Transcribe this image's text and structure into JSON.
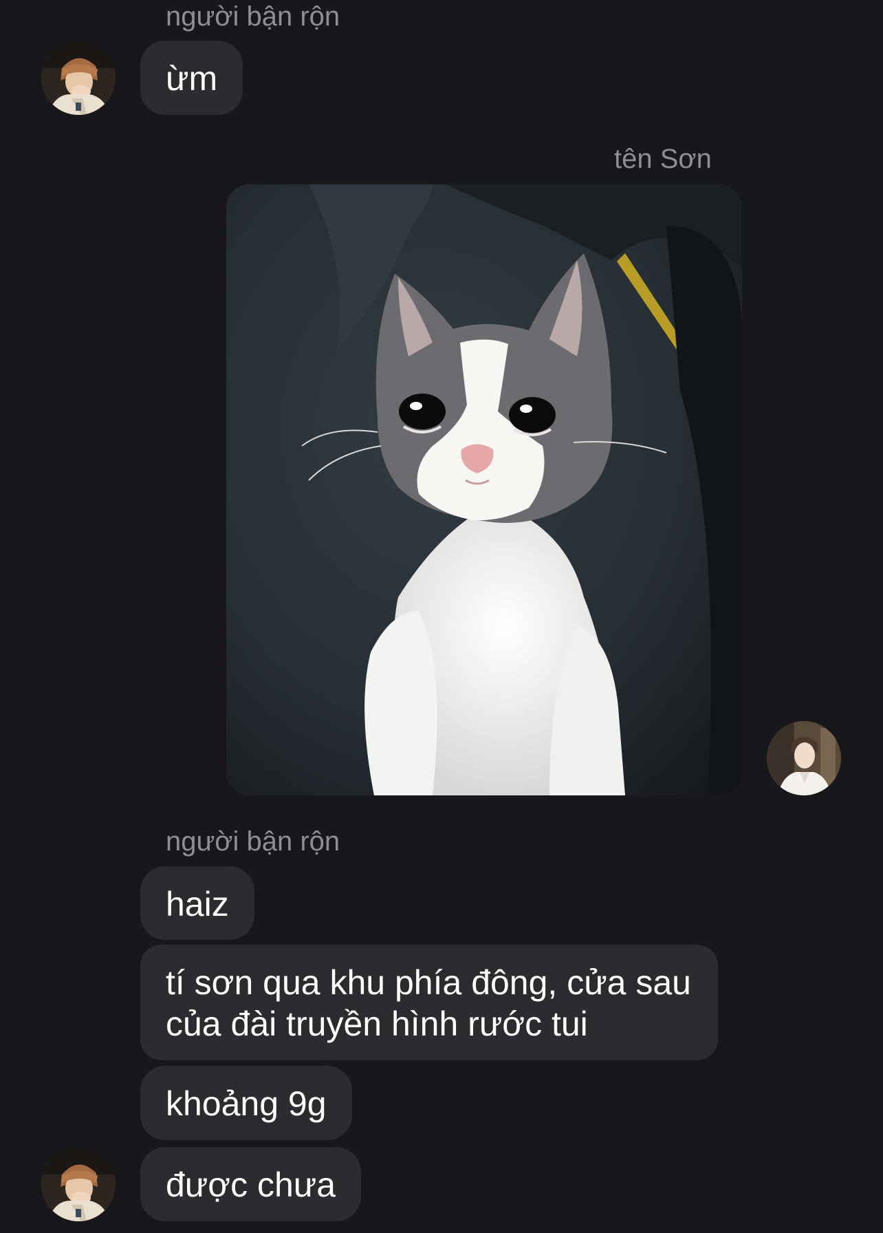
{
  "conversation": {
    "group1": {
      "sender": "người bận rộn",
      "messages": [
        "ừm"
      ]
    },
    "group2": {
      "sender": "tên Sơn",
      "attachment": "crying-cat-photo"
    },
    "group3": {
      "sender": "người bận rộn",
      "messages": [
        "haiz",
        "tí sơn qua khu phía đông, cửa sau của đài truyền hình rước tui",
        "khoảng 9g",
        "được chưa"
      ]
    }
  },
  "colors": {
    "background": "#18181c",
    "bubble": "#2b2b30",
    "sender_name": "#8e8e93",
    "text": "#ffffff"
  },
  "icons": {
    "left_avatar": "avatar-person-covering-face",
    "right_avatar": "avatar-person-white-shirt"
  }
}
